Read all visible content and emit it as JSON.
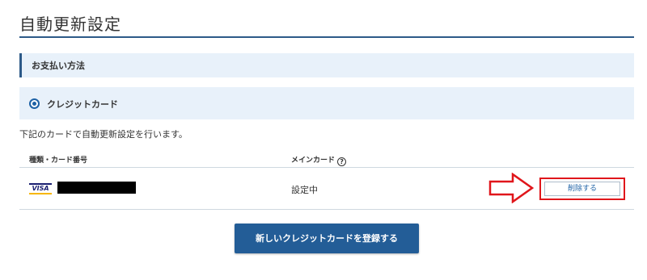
{
  "page": {
    "title": "自動更新設定"
  },
  "payment_section": {
    "header": "お支払い方法",
    "method_label": "クレジットカード",
    "description": "下記のカードで自動更新設定を行います。"
  },
  "card_table": {
    "columns": {
      "type_number": "種類・カード番号",
      "main_card": "メインカード"
    },
    "help_glyph": "?",
    "rows": [
      {
        "brand": "VISA",
        "status": "設定中",
        "delete_label": "削除する"
      }
    ]
  },
  "actions": {
    "register_label": "新しいクレジットカードを登録する"
  },
  "colors": {
    "accent": "#235d97",
    "section_bg": "#e8f1fa",
    "highlight_red": "#e0161b"
  },
  "icons": {
    "help": "question-circle-icon",
    "annotation": "right-arrow-icon"
  }
}
